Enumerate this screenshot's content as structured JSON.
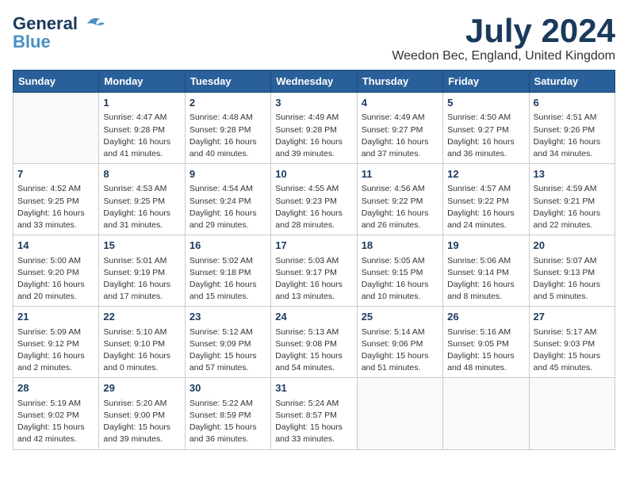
{
  "header": {
    "logo_line1": "General",
    "logo_line2": "Blue",
    "month": "July 2024",
    "location": "Weedon Bec, England, United Kingdom"
  },
  "weekdays": [
    "Sunday",
    "Monday",
    "Tuesday",
    "Wednesday",
    "Thursday",
    "Friday",
    "Saturday"
  ],
  "weeks": [
    [
      {
        "day": "",
        "sunrise": "",
        "sunset": "",
        "daylight": ""
      },
      {
        "day": "1",
        "sunrise": "Sunrise: 4:47 AM",
        "sunset": "Sunset: 9:28 PM",
        "daylight": "Daylight: 16 hours and 41 minutes."
      },
      {
        "day": "2",
        "sunrise": "Sunrise: 4:48 AM",
        "sunset": "Sunset: 9:28 PM",
        "daylight": "Daylight: 16 hours and 40 minutes."
      },
      {
        "day": "3",
        "sunrise": "Sunrise: 4:49 AM",
        "sunset": "Sunset: 9:28 PM",
        "daylight": "Daylight: 16 hours and 39 minutes."
      },
      {
        "day": "4",
        "sunrise": "Sunrise: 4:49 AM",
        "sunset": "Sunset: 9:27 PM",
        "daylight": "Daylight: 16 hours and 37 minutes."
      },
      {
        "day": "5",
        "sunrise": "Sunrise: 4:50 AM",
        "sunset": "Sunset: 9:27 PM",
        "daylight": "Daylight: 16 hours and 36 minutes."
      },
      {
        "day": "6",
        "sunrise": "Sunrise: 4:51 AM",
        "sunset": "Sunset: 9:26 PM",
        "daylight": "Daylight: 16 hours and 34 minutes."
      }
    ],
    [
      {
        "day": "7",
        "sunrise": "Sunrise: 4:52 AM",
        "sunset": "Sunset: 9:25 PM",
        "daylight": "Daylight: 16 hours and 33 minutes."
      },
      {
        "day": "8",
        "sunrise": "Sunrise: 4:53 AM",
        "sunset": "Sunset: 9:25 PM",
        "daylight": "Daylight: 16 hours and 31 minutes."
      },
      {
        "day": "9",
        "sunrise": "Sunrise: 4:54 AM",
        "sunset": "Sunset: 9:24 PM",
        "daylight": "Daylight: 16 hours and 29 minutes."
      },
      {
        "day": "10",
        "sunrise": "Sunrise: 4:55 AM",
        "sunset": "Sunset: 9:23 PM",
        "daylight": "Daylight: 16 hours and 28 minutes."
      },
      {
        "day": "11",
        "sunrise": "Sunrise: 4:56 AM",
        "sunset": "Sunset: 9:22 PM",
        "daylight": "Daylight: 16 hours and 26 minutes."
      },
      {
        "day": "12",
        "sunrise": "Sunrise: 4:57 AM",
        "sunset": "Sunset: 9:22 PM",
        "daylight": "Daylight: 16 hours and 24 minutes."
      },
      {
        "day": "13",
        "sunrise": "Sunrise: 4:59 AM",
        "sunset": "Sunset: 9:21 PM",
        "daylight": "Daylight: 16 hours and 22 minutes."
      }
    ],
    [
      {
        "day": "14",
        "sunrise": "Sunrise: 5:00 AM",
        "sunset": "Sunset: 9:20 PM",
        "daylight": "Daylight: 16 hours and 20 minutes."
      },
      {
        "day": "15",
        "sunrise": "Sunrise: 5:01 AM",
        "sunset": "Sunset: 9:19 PM",
        "daylight": "Daylight: 16 hours and 17 minutes."
      },
      {
        "day": "16",
        "sunrise": "Sunrise: 5:02 AM",
        "sunset": "Sunset: 9:18 PM",
        "daylight": "Daylight: 16 hours and 15 minutes."
      },
      {
        "day": "17",
        "sunrise": "Sunrise: 5:03 AM",
        "sunset": "Sunset: 9:17 PM",
        "daylight": "Daylight: 16 hours and 13 minutes."
      },
      {
        "day": "18",
        "sunrise": "Sunrise: 5:05 AM",
        "sunset": "Sunset: 9:15 PM",
        "daylight": "Daylight: 16 hours and 10 minutes."
      },
      {
        "day": "19",
        "sunrise": "Sunrise: 5:06 AM",
        "sunset": "Sunset: 9:14 PM",
        "daylight": "Daylight: 16 hours and 8 minutes."
      },
      {
        "day": "20",
        "sunrise": "Sunrise: 5:07 AM",
        "sunset": "Sunset: 9:13 PM",
        "daylight": "Daylight: 16 hours and 5 minutes."
      }
    ],
    [
      {
        "day": "21",
        "sunrise": "Sunrise: 5:09 AM",
        "sunset": "Sunset: 9:12 PM",
        "daylight": "Daylight: 16 hours and 2 minutes."
      },
      {
        "day": "22",
        "sunrise": "Sunrise: 5:10 AM",
        "sunset": "Sunset: 9:10 PM",
        "daylight": "Daylight: 16 hours and 0 minutes."
      },
      {
        "day": "23",
        "sunrise": "Sunrise: 5:12 AM",
        "sunset": "Sunset: 9:09 PM",
        "daylight": "Daylight: 15 hours and 57 minutes."
      },
      {
        "day": "24",
        "sunrise": "Sunrise: 5:13 AM",
        "sunset": "Sunset: 9:08 PM",
        "daylight": "Daylight: 15 hours and 54 minutes."
      },
      {
        "day": "25",
        "sunrise": "Sunrise: 5:14 AM",
        "sunset": "Sunset: 9:06 PM",
        "daylight": "Daylight: 15 hours and 51 minutes."
      },
      {
        "day": "26",
        "sunrise": "Sunrise: 5:16 AM",
        "sunset": "Sunset: 9:05 PM",
        "daylight": "Daylight: 15 hours and 48 minutes."
      },
      {
        "day": "27",
        "sunrise": "Sunrise: 5:17 AM",
        "sunset": "Sunset: 9:03 PM",
        "daylight": "Daylight: 15 hours and 45 minutes."
      }
    ],
    [
      {
        "day": "28",
        "sunrise": "Sunrise: 5:19 AM",
        "sunset": "Sunset: 9:02 PM",
        "daylight": "Daylight: 15 hours and 42 minutes."
      },
      {
        "day": "29",
        "sunrise": "Sunrise: 5:20 AM",
        "sunset": "Sunset: 9:00 PM",
        "daylight": "Daylight: 15 hours and 39 minutes."
      },
      {
        "day": "30",
        "sunrise": "Sunrise: 5:22 AM",
        "sunset": "Sunset: 8:59 PM",
        "daylight": "Daylight: 15 hours and 36 minutes."
      },
      {
        "day": "31",
        "sunrise": "Sunrise: 5:24 AM",
        "sunset": "Sunset: 8:57 PM",
        "daylight": "Daylight: 15 hours and 33 minutes."
      },
      {
        "day": "",
        "sunrise": "",
        "sunset": "",
        "daylight": ""
      },
      {
        "day": "",
        "sunrise": "",
        "sunset": "",
        "daylight": ""
      },
      {
        "day": "",
        "sunrise": "",
        "sunset": "",
        "daylight": ""
      }
    ]
  ]
}
